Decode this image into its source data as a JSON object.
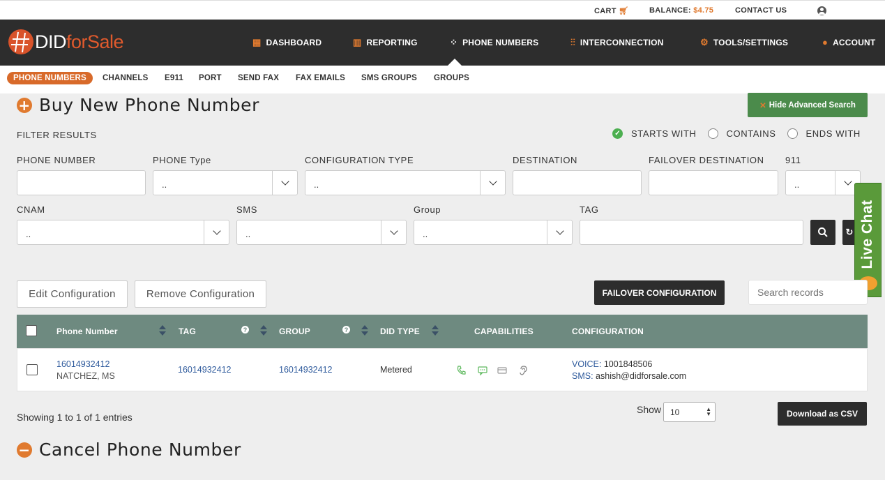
{
  "topbar": {
    "cart": "CART",
    "balance_label": "BALANCE:",
    "balance_value": "$4.75",
    "contact": "CONTACT US"
  },
  "logo": {
    "part1": "DID",
    "part2": "for",
    "part3": "Sale"
  },
  "nav": {
    "dashboard": "DASHBOARD",
    "reporting": "REPORTING",
    "phone_numbers": "PHONE NUMBERS",
    "interconnection": "INTERCONNECTION",
    "tools": "TOOLS/SETTINGS",
    "account": "ACCOUNT"
  },
  "subnav": {
    "phone_numbers": "PHONE NUMBERS",
    "channels": "CHANNELS",
    "e911": "E911",
    "port": "PORT",
    "send_fax": "SEND FAX",
    "fax_emails": "FAX EMAILS",
    "sms_groups": "SMS GROUPS",
    "groups": "GROUPS"
  },
  "buy_section": {
    "title": "Buy New Phone Number",
    "hide_search": "Hide Advanced Search"
  },
  "filter": {
    "title": "FILTER RESULTS",
    "starts_with": "STARTS WITH",
    "contains": "CONTAINS",
    "ends_with": "ENDS WITH",
    "phone_number": "PHONE NUMBER",
    "phone_type": "PHONE Type",
    "config_type": "CONFIGURATION TYPE",
    "destination": "DESTINATION",
    "failover_destination": "FAILOVER DESTINATION",
    "e911": "911",
    "cnam": "CNAM",
    "sms": "SMS",
    "group": "Group",
    "tag": "TAG",
    "select_placeholder": ".."
  },
  "actions": {
    "edit_config": "Edit Configuration",
    "remove_config": "Remove Configuration",
    "failover_config": "FAILOVER CONFIGURATION",
    "search_placeholder": "Search records"
  },
  "table": {
    "headers": {
      "phone_number": "Phone Number",
      "tag": "TAG",
      "group": "GROUP",
      "did_type": "DID TYPE",
      "capabilities": "CAPABILITIES",
      "configuration": "CONFIGURATION"
    },
    "rows": [
      {
        "phone_number": "16014932412",
        "location": "NATCHEZ, MS",
        "tag": "16014932412",
        "group": "16014932412",
        "did_type": "Metered",
        "voice_label": "VOICE:",
        "voice_value": "1001848506",
        "sms_label": "SMS:",
        "sms_value": "ashish@didforsale.com"
      }
    ]
  },
  "footer": {
    "showing": "Showing 1 to 1 of 1 entries",
    "show_label": "Show",
    "page_size": "10",
    "download_csv": "Download as CSV"
  },
  "cancel_section": {
    "title": "Cancel Phone Number"
  },
  "livechat": {
    "label": "Live Chat"
  },
  "colors": {
    "accent": "#e07a2f",
    "nav_bg": "#2d2d2d",
    "table_header": "#6e8a80",
    "green_button": "#4b8b4b",
    "link": "#2e5a9c"
  }
}
